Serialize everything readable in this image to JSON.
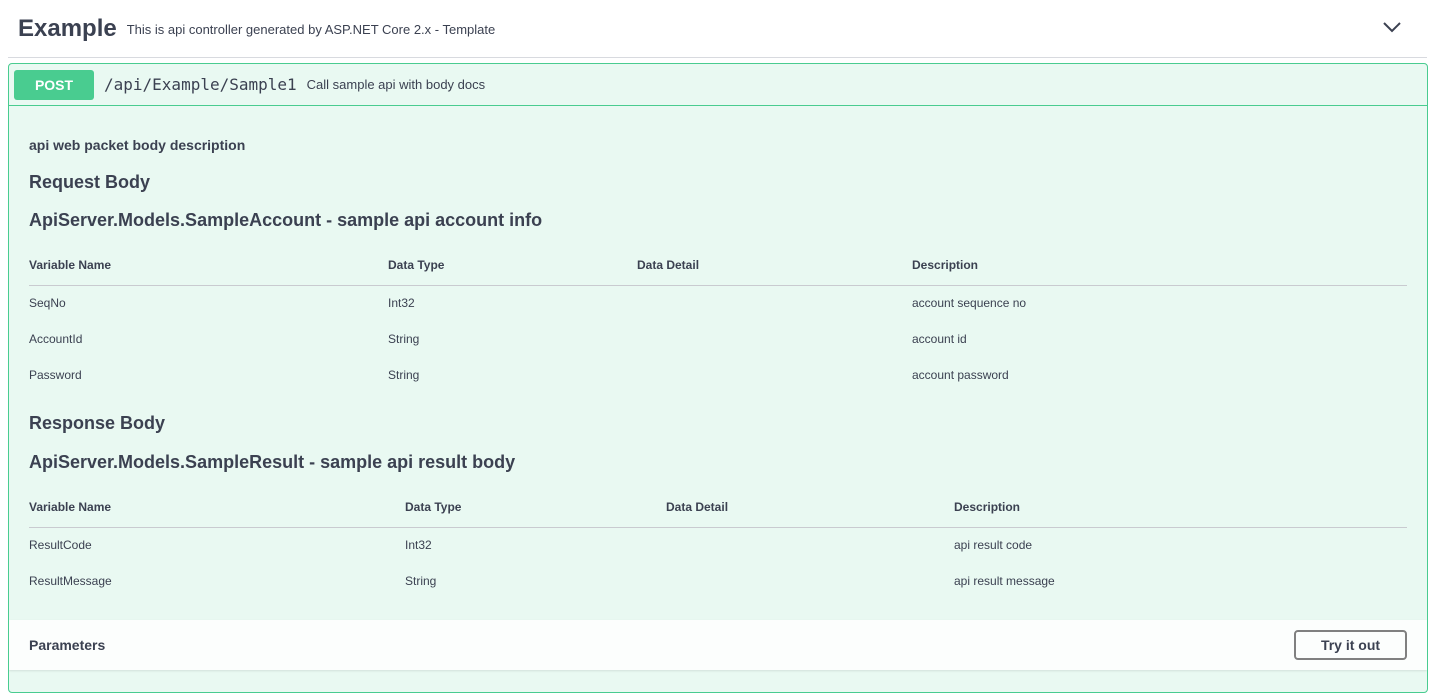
{
  "tag": {
    "title": "Example",
    "description": "This is api controller generated by ASP.NET Core 2.x - Template",
    "toggle_icon": "chevron-down-icon"
  },
  "operation": {
    "method": "POST",
    "path": "/api/Example/Sample1",
    "summary": "Call sample api with body docs",
    "body_description": "api web packet body description",
    "request": {
      "heading": "Request Body",
      "model_title": "ApiServer.Models.SampleAccount - sample api account info",
      "columns": [
        "Variable Name",
        "Data Type",
        "Data Detail",
        "Description"
      ],
      "rows": [
        {
          "name": "SeqNo",
          "type": "Int32",
          "detail": "",
          "description": "account sequence no"
        },
        {
          "name": "AccountId",
          "type": "String",
          "detail": "",
          "description": "account id"
        },
        {
          "name": "Password",
          "type": "String",
          "detail": "",
          "description": "account password"
        }
      ]
    },
    "response": {
      "heading": "Response Body",
      "model_title": "ApiServer.Models.SampleResult - sample api result body",
      "columns": [
        "Variable Name",
        "Data Type",
        "Data Detail",
        "Description"
      ],
      "rows": [
        {
          "name": "ResultCode",
          "type": "Int32",
          "detail": "",
          "description": "api result code"
        },
        {
          "name": "ResultMessage",
          "type": "String",
          "detail": "",
          "description": "api result message"
        }
      ]
    },
    "parameters": {
      "title": "Parameters",
      "try_button": "Try it out"
    }
  },
  "colors": {
    "post_accent": "#49cc90",
    "text": "#3b4151"
  }
}
